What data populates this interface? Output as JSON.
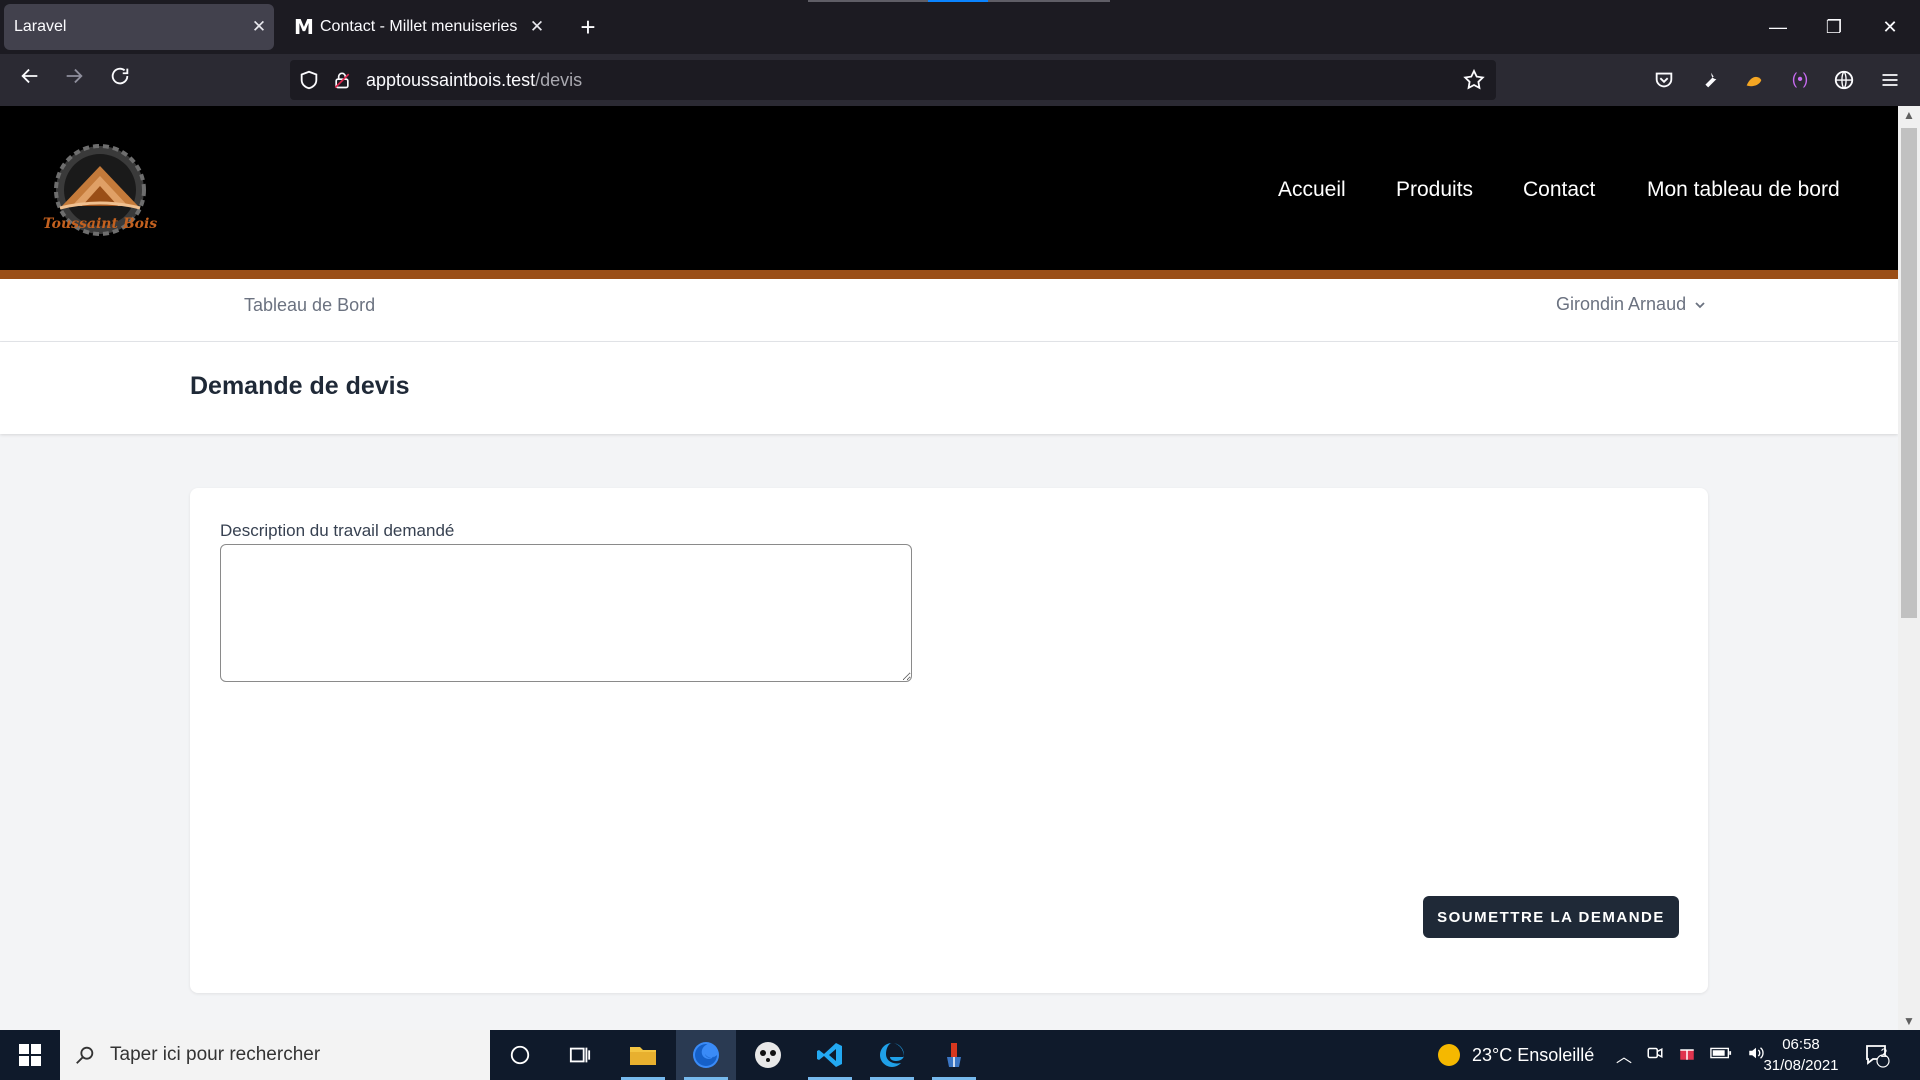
{
  "browser": {
    "tabs": [
      {
        "title": "Laravel",
        "active": true
      },
      {
        "title": "Contact - Millet menuiseries po",
        "active": false
      }
    ],
    "url_host": "apptoussaintbois.test",
    "url_path": "/devis"
  },
  "site": {
    "logo_text": "Toussaint Bois",
    "nav": [
      "Accueil",
      "Produits",
      "Contact",
      "Mon tableau de bord"
    ],
    "accent_color": "#9a4e17"
  },
  "subnav": {
    "dashboard_link": "Tableau de Bord",
    "user_name": "Girondin Arnaud"
  },
  "page": {
    "title": "Demande de devis",
    "field_label": "Description du travail demandé",
    "field_value": "",
    "submit_label": "SOUMETTRE LA DEMANDE"
  },
  "taskbar": {
    "search_placeholder": "Taper ici pour rechercher",
    "weather": "23°C  Ensoleillé",
    "time": "06:58",
    "date": "31/08/2021",
    "notification_count": "2"
  }
}
